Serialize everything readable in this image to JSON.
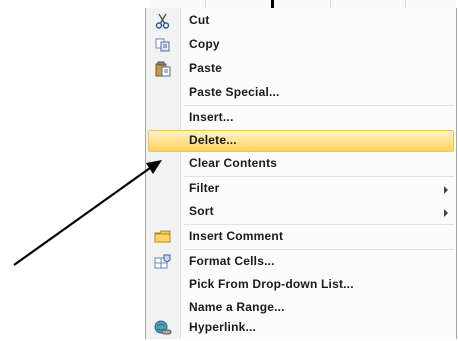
{
  "menu": {
    "items": [
      {
        "label": "Cut",
        "icon": "scissors-icon"
      },
      {
        "label": "Copy",
        "icon": "copy-icon"
      },
      {
        "label": "Paste",
        "icon": "paste-icon"
      },
      {
        "label": "Paste Special..."
      },
      {
        "label": "Insert..."
      },
      {
        "label": "Delete...",
        "highlighted": true
      },
      {
        "label": "Clear Contents"
      },
      {
        "label": "Filter",
        "submenu": true
      },
      {
        "label": "Sort",
        "submenu": true
      },
      {
        "label": "Insert Comment",
        "icon": "comment-icon"
      },
      {
        "label": "Format Cells...",
        "icon": "format-cells-icon"
      },
      {
        "label": "Pick From Drop-down List..."
      },
      {
        "label": "Name a Range..."
      },
      {
        "label": "Hyperlink...",
        "icon": "hyperlink-icon"
      }
    ]
  },
  "colors": {
    "highlight": "#ffd35a",
    "gutter": "#f2f2f2",
    "arrow": "#000000"
  }
}
